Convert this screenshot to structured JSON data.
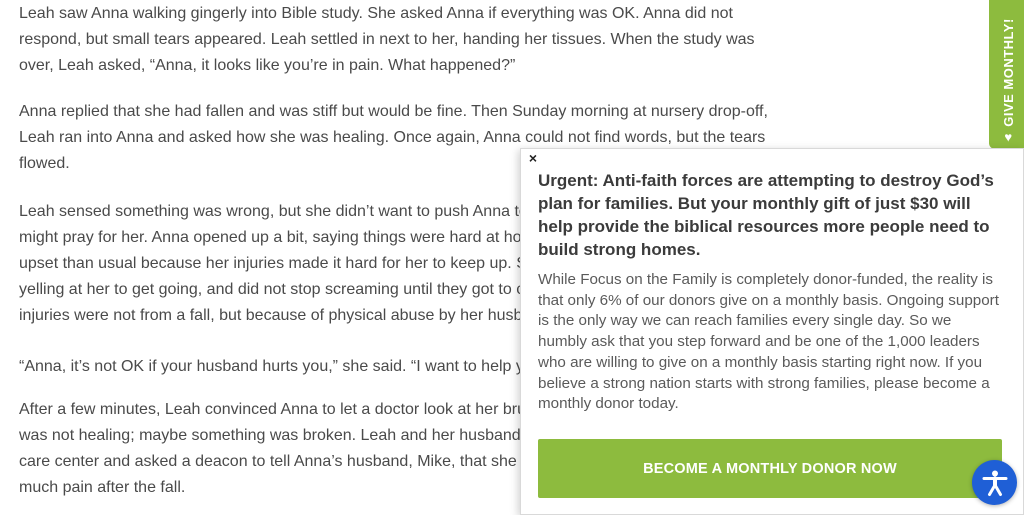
{
  "article": {
    "p1": [
      "Leah saw Anna walking gingerly into Bible study. She asked Anna if everything was OK. Anna did not",
      "respond, but small tears appeared. Leah settled in next to her, handing her tissues. When the study was",
      "over, Leah asked, “Anna, it looks like you’re in pain. What happened?”"
    ],
    "p2": [
      "Anna replied that she had fallen and was stiff but would be fine. Then Sunday morning at nursery drop-off,",
      "Leah ran into Anna and asked how she was healing. Once again, Anna could not find words, but the tears",
      "flowed."
    ],
    "p3": [
      "Leah sensed something was wrong, but she didn’t want to push Anna to t",
      "might pray for her. Anna opened up a bit, saying things were hard at home",
      "upset than usual because her injuries made it hard for her to keep up. She",
      "yelling at her to get going, and did not stop screaming until they got to chu",
      "injuries were not from a fall, but because of physical abuse by her husban"
    ],
    "p4": [
      "“Anna, it’s not OK if your husband hurts you,” she said. “I want to help you.”"
    ],
    "p5": [
      "After a few minutes, Leah convinced Anna to let a doctor look at her bruis",
      "was not healing; maybe something was broken. Leah and her husband to",
      "care center and asked a deacon to tell Anna’s husband, Mike, that she left",
      "much pain after the fall."
    ]
  },
  "side_tab": {
    "label": "GIVE MONTHLY!",
    "icon": "heart-icon"
  },
  "popup": {
    "close_label": "×",
    "headline": "Urgent: Anti-faith forces are attempting to destroy God’s plan for families. But your monthly gift of just $30 will help provide the biblical resources more people need to build strong homes.",
    "body": "While Focus on the Family is completely donor-funded, the reality is that only 6% of our donors give on a monthly basis. Ongoing support is the only way we can reach families every single day. So we humbly ask that you step forward and be one of the 1,000 leaders who are willing to give on a monthly basis starting right now. If you believe a strong nation starts with strong families, please become a monthly donor today.",
    "button_label": "BECOME A MONTHLY DONOR NOW"
  },
  "colors": {
    "accent_green": "#8dbb3e",
    "accessibility_blue": "#1f5fd6",
    "text_gray": "#4a4a4a"
  },
  "accessibility": {
    "icon": "accessibility-icon"
  }
}
